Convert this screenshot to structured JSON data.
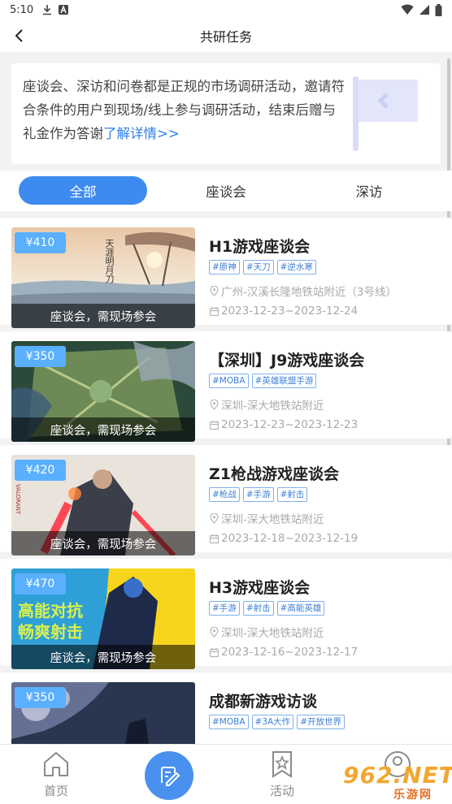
{
  "status": {
    "time": "5:10",
    "icons": [
      "download-icon",
      "a-badge-icon",
      "wifi-icon",
      "signal-icon",
      "battery-icon"
    ]
  },
  "header": {
    "title": "共研任务",
    "back_icon": "back-arrow-icon"
  },
  "intro": {
    "text": "座谈会、深访和问卷都是正规的市场调研活动，邀请符合条件的用户到现场/线上参与调研活动，结束后赠与礼金作为答谢",
    "link": "了解详情>>",
    "icon": "flag-icon"
  },
  "tabs": [
    {
      "label": "全部",
      "active": true
    },
    {
      "label": "座谈会",
      "active": false
    },
    {
      "label": "深访",
      "active": false
    }
  ],
  "tasks": [
    {
      "price": "¥410",
      "caption": "座谈会，需现场参会",
      "title": "H1游戏座谈会",
      "tags": [
        "#原神",
        "#天刀",
        "#逆水寒"
      ],
      "location": "广州-汉溪长隆地铁站附近（3号线）",
      "date": "2023-12-23~2023-12-24"
    },
    {
      "price": "¥350",
      "caption": "座谈会，需现场参会",
      "title": "【深圳】J9游戏座谈会",
      "tags": [
        "#MOBA",
        "#英雄联盟手游"
      ],
      "location": "深圳-深大地铁站附近",
      "date": "2023-12-23~2023-12-23"
    },
    {
      "price": "¥420",
      "caption": "座谈会，需现场参会",
      "title": "Z1枪战游戏座谈会",
      "tags": [
        "#枪战",
        "#手游",
        "#射击"
      ],
      "location": "深圳-深大地铁站附近",
      "date": "2023-12-18~2023-12-19"
    },
    {
      "price": "¥470",
      "caption": "座谈会，需现场参会",
      "title": "H3游戏座谈会",
      "tags": [
        "#手游",
        "#射击",
        "#高能英雄"
      ],
      "location": "深圳-深大地铁站附近",
      "date": "2023-12-16~2023-12-17"
    },
    {
      "price": "¥350",
      "caption": "",
      "title": "成都新游戏访谈",
      "tags": [
        "#MOBA",
        "#3A大作",
        "#开放世界"
      ],
      "location": "",
      "date": ""
    }
  ],
  "thumb_texts": {
    "t1_logo": "天涯明月刀",
    "t3_side": "VALORANT",
    "t4_line1": "高能对抗",
    "t4_line2": "畅爽射击"
  },
  "bottom_nav": {
    "home": "首页",
    "activity": "活动"
  },
  "watermark": {
    "main": "962.NET",
    "sub": "乐游网"
  },
  "colors": {
    "accent": "#3d8af0",
    "price_badge": "#5ab0ff",
    "tag_text": "#3d7fd6",
    "link": "#2f7fe8"
  }
}
